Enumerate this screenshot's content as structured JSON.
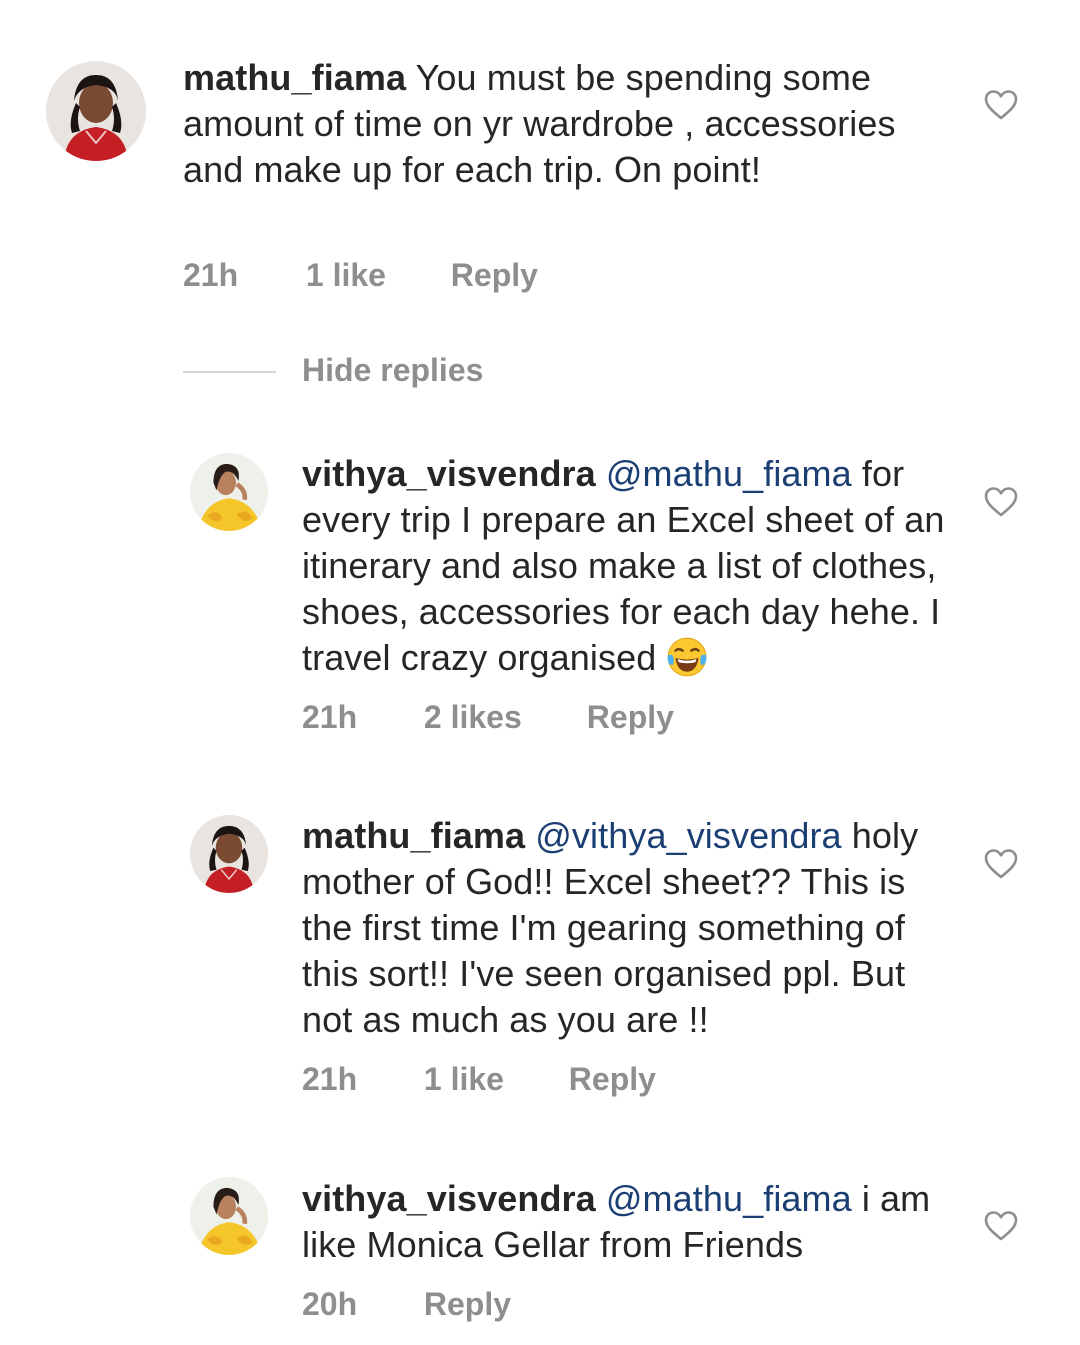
{
  "comments": [
    {
      "username": "mathu_fiama",
      "mention": "",
      "text": "You must be spending some amount of time on yr wardrobe , accessories and make up for each trip. On point!",
      "time": "21h",
      "likes": "1 like",
      "reply": "Reply"
    },
    {
      "username": "vithya_visvendra",
      "mention": "@mathu_fiama",
      "text": "for every trip I prepare an Excel sheet of an itinerary and also make a list of clothes, shoes, accessories for each day hehe. I travel crazy organised",
      "emoji": "face-with-tears-of-joy",
      "time": "21h",
      "likes": "2 likes",
      "reply": "Reply"
    },
    {
      "username": "mathu_fiama",
      "mention": "@vithya_visvendra",
      "text": "holy mother of God!! Excel sheet?? This is the first time I'm gearing something of this sort!! I've seen organised ppl. But not as much as you are !!",
      "time": "21h",
      "likes": "1 like",
      "reply": "Reply"
    },
    {
      "username": "vithya_visvendra",
      "mention": "@mathu_fiama",
      "text": "i am like Monica Gellar from Friends",
      "time": "20h",
      "likes": "",
      "reply": "Reply"
    }
  ],
  "hide_replies": "Hide replies",
  "colors": {
    "username": "#262626",
    "mention": "#1b3f73",
    "meta": "#8e8e8e",
    "heart": "#8e8e8e"
  },
  "icons": [
    "heart-icon",
    "avatar-mathu",
    "avatar-vithya",
    "laughing-emoji"
  ]
}
